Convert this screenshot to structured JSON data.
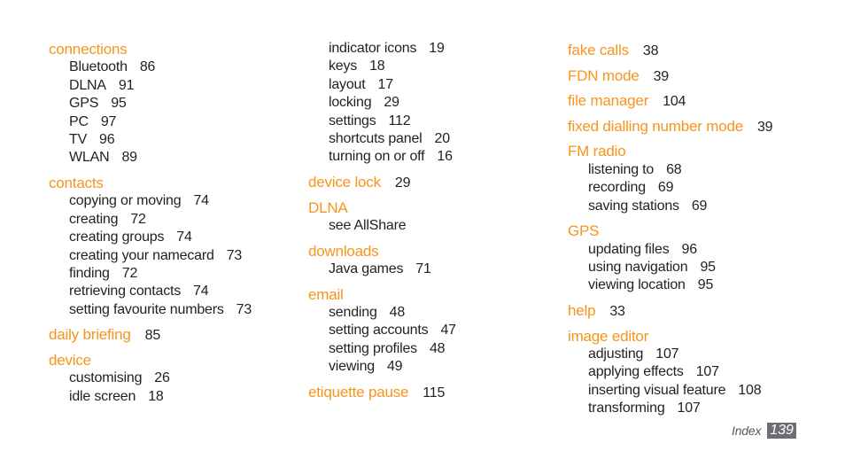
{
  "colors": {
    "heading": "#f7941d",
    "text": "#231f20",
    "page_badge_bg": "#6d6e71"
  },
  "columns": [
    {
      "entries": [
        {
          "term": "connections",
          "page": "",
          "subentries": [
            {
              "term": "Bluetooth",
              "page": "86"
            },
            {
              "term": "DLNA",
              "page": "91"
            },
            {
              "term": "GPS",
              "page": "95"
            },
            {
              "term": "PC",
              "page": "97"
            },
            {
              "term": "TV",
              "page": "96"
            },
            {
              "term": "WLAN",
              "page": "89"
            }
          ]
        },
        {
          "term": "contacts",
          "page": "",
          "subentries": [
            {
              "term": "copying or moving",
              "page": "74"
            },
            {
              "term": "creating",
              "page": "72"
            },
            {
              "term": "creating groups",
              "page": "74"
            },
            {
              "term": "creating your namecard",
              "page": "73"
            },
            {
              "term": "finding",
              "page": "72"
            },
            {
              "term": "retrieving contacts",
              "page": "74"
            },
            {
              "term": "setting favourite numbers",
              "page": "73"
            }
          ]
        },
        {
          "term": "daily briefing",
          "page": "85",
          "subentries": []
        },
        {
          "term": "device",
          "page": "",
          "subentries": [
            {
              "term": "customising",
              "page": "26"
            },
            {
              "term": "idle screen",
              "page": "18"
            }
          ]
        }
      ]
    },
    {
      "entries": [
        {
          "term": "",
          "page": "",
          "continued": true,
          "subentries": [
            {
              "term": "indicator icons",
              "page": "19"
            },
            {
              "term": "keys",
              "page": "18"
            },
            {
              "term": "layout",
              "page": "17"
            },
            {
              "term": "locking",
              "page": "29"
            },
            {
              "term": "settings",
              "page": "112"
            },
            {
              "term": "shortcuts panel",
              "page": "20"
            },
            {
              "term": "turning on or off",
              "page": "16"
            }
          ]
        },
        {
          "term": "device lock",
          "page": "29",
          "subentries": []
        },
        {
          "term": "DLNA",
          "page": "",
          "subentries": [
            {
              "term": "see AllShare",
              "page": ""
            }
          ]
        },
        {
          "term": "downloads",
          "page": "",
          "subentries": [
            {
              "term": "Java games",
              "page": "71"
            }
          ]
        },
        {
          "term": "email",
          "page": "",
          "subentries": [
            {
              "term": "sending",
              "page": "48"
            },
            {
              "term": "setting accounts",
              "page": "47"
            },
            {
              "term": "setting profiles",
              "page": "48"
            },
            {
              "term": "viewing",
              "page": "49"
            }
          ]
        },
        {
          "term": "etiquette pause",
          "page": "115",
          "subentries": []
        }
      ]
    },
    {
      "entries": [
        {
          "term": "fake calls",
          "page": "38",
          "subentries": []
        },
        {
          "term": "FDN mode",
          "page": "39",
          "subentries": []
        },
        {
          "term": "file manager",
          "page": "104",
          "subentries": []
        },
        {
          "term": "fixed dialling number mode",
          "page": "39",
          "subentries": []
        },
        {
          "term": "FM radio",
          "page": "",
          "subentries": [
            {
              "term": "listening to",
              "page": "68"
            },
            {
              "term": "recording",
              "page": "69"
            },
            {
              "term": "saving stations",
              "page": "69"
            }
          ]
        },
        {
          "term": "GPS",
          "page": "",
          "subentries": [
            {
              "term": "updating files",
              "page": "96"
            },
            {
              "term": "using navigation",
              "page": "95"
            },
            {
              "term": "viewing location",
              "page": "95"
            }
          ]
        },
        {
          "term": "help",
          "page": "33",
          "subentries": []
        },
        {
          "term": "image editor",
          "page": "",
          "subentries": [
            {
              "term": "adjusting",
              "page": "107"
            },
            {
              "term": "applying effects",
              "page": "107"
            },
            {
              "term": "inserting visual feature",
              "page": "108"
            },
            {
              "term": "transforming",
              "page": "107"
            }
          ]
        }
      ]
    }
  ],
  "footer": {
    "section": "Index",
    "page_number": "139"
  }
}
